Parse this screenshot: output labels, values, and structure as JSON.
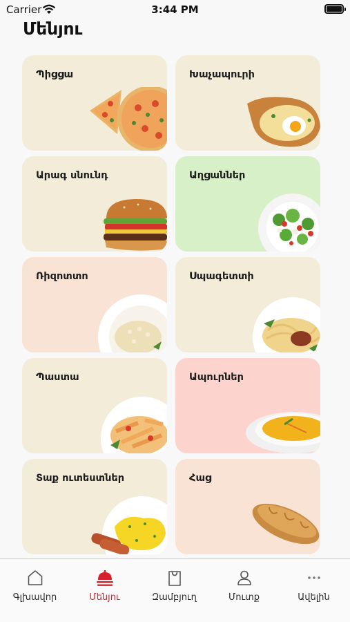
{
  "status_bar": {
    "carrier": "Carrier",
    "time": "3:44 PM"
  },
  "page_title": "Մենյու",
  "menu": [
    {
      "label": "Պիցցա",
      "bg": "#f2ecd8",
      "art": "pizza"
    },
    {
      "label": "Խաչապուրի",
      "bg": "#f2ecd8",
      "art": "khachapuri"
    },
    {
      "label": "Արագ սնունդ",
      "bg": "#f2ecd8",
      "art": "burger"
    },
    {
      "label": "Աղցաններ",
      "bg": "#d8f0c8",
      "art": "salad"
    },
    {
      "label": "Ռիզոտտո",
      "bg": "#f9e3d4",
      "art": "risotto"
    },
    {
      "label": "Սպագետտի",
      "bg": "#f2ecd8",
      "art": "spaghetti"
    },
    {
      "label": "Պաստա",
      "bg": "#f2ecd8",
      "art": "pasta"
    },
    {
      "label": "Ապուրներ",
      "bg": "#fcd3cd",
      "art": "soup"
    },
    {
      "label": "Տաք ուտեստներ",
      "bg": "#f2ecd8",
      "art": "hot-dishes"
    },
    {
      "label": "Հաց",
      "bg": "#f9e3d4",
      "art": "bread"
    }
  ],
  "tab_bar": {
    "accent": "#d6212a",
    "tabs": [
      {
        "label": "Գլխավոր",
        "icon": "home-icon",
        "active": false
      },
      {
        "label": "Մենյու",
        "icon": "cloche-icon",
        "active": true
      },
      {
        "label": "Զամբյուղ",
        "icon": "bag-icon",
        "active": false
      },
      {
        "label": "Մուտք",
        "icon": "user-icon",
        "active": false
      },
      {
        "label": "Ավելին",
        "icon": "more-icon",
        "active": false
      }
    ]
  }
}
